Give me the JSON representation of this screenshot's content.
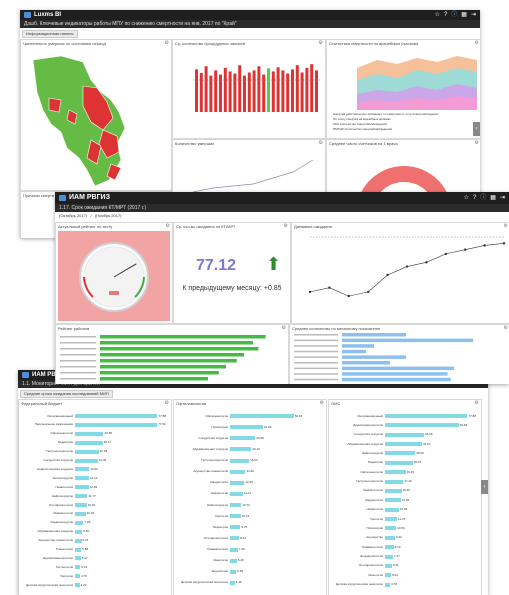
{
  "window1": {
    "app_title": "Luxms BI",
    "subtitle": "Дэшб. Ключевые индикаторы работы МПУ по снижению смертности на янв. 2017 по \"Край\"",
    "tab": "Информационная панель",
    "panels": {
      "map": "Численность умерших по состоянию период",
      "bars": "Ср. количество процедурных записей",
      "area": "Статистика смертности по врачебным участкам",
      "line": "Количество умерших",
      "donut": "Среднее число счетчиков на 1 врача",
      "bottom": "Причины смерти по участку"
    },
    "area_legend": [
      "Смертей действительно связанных со смертями от отсутствия наблюдения",
      "По числу смертей на врачебных приёмах",
      "ОКС Количество смертей/наблюдений",
      "ИМ/ОКС Количество смертей/наблюдения"
    ],
    "colors": {
      "red": "#dd3333",
      "green": "#66bb44",
      "accent_bar": "#55cc55"
    }
  },
  "window2": {
    "app_title": "ИАМ РВГИЗ",
    "subtitle": "1.17. Срок ожидания КТ/МРТ (2017 г.)",
    "breadcrumb": "(Октябрь 2017)   /   (Ноябрь 2017)",
    "panels": {
      "gauge": "Актуальный рейтинг по тесту",
      "kpi": "Ср. кол-во ожидания по КТ/МРТ",
      "trend": "Динамика ожидания",
      "bars_left": "Рейтинг районов",
      "bars_right": "Среднее количество по месячному показателю"
    },
    "kpi_value": "77.12",
    "kpi_caption": "К предыдущему месяцу: +0.85",
    "gauge_value_fraction": 0.72,
    "trend_values": [
      5,
      6,
      4,
      5,
      9,
      11,
      12,
      14,
      15,
      16,
      16.5
    ],
    "left_bars": [
      0.92,
      0.85,
      0.88,
      0.8,
      0.76,
      0.7,
      0.66,
      0.6
    ],
    "right_bars": [
      0.4,
      0.82,
      0.2,
      0.15,
      0.4,
      0.3,
      0.7,
      0.66,
      0.68
    ],
    "colors": {
      "up_arrow": "#2e8b2e",
      "kpi_text": "#7a7acc",
      "gauge_bg": "#f2a3a3"
    }
  },
  "window3": {
    "app_title": "ИАМ РВГИЗ",
    "subtitle": "1.1. Мониторинг МИП для врачей",
    "tab": "Средние сроки ожидания исследований МИП",
    "panels": {
      "p1": "Федеральный бюджет",
      "p2": "Офтальмология",
      "p3": "ОМС"
    },
    "charts": [
      {
        "labels": [
          "Интервенционный",
          "Персональное разрешение",
          "Офтальмология",
          "Педиатрия",
          "Гастроэнтерология",
          "Сосудистая хирургия",
          "Невралгическая хирургия",
          "Ангиохирургия",
          "Гематология",
          "Нейрохирургия",
          "Отоларингология",
          "Ревматология",
          "Кардиохирургия",
          "Абдоминальная хирургия",
          "Акушерство-гинекология",
          "Гинекология",
          "Дерматовенерология",
          "Гастрология",
          "Урология",
          "Детская хирургическая онкология"
        ],
        "values": [
          77.88,
          77.54,
          26.88,
          26.17,
          22.33,
          21.45,
          13.52,
          13.14,
          12.89,
          11.77,
          10.93,
          10.02,
          7.95,
          6.82,
          6.15,
          5.88,
          5.47,
          5.01,
          4.76,
          4.29
        ]
      },
      {
        "labels": [
          "Офтальмология",
          "Психиатрия",
          "Сосудистая хирургия",
          "Абдоминальная хирургия",
          "Гастроэнтерология",
          "Акушерство-гинекология",
          "Кардиология",
          "Нефрология",
          "Нейрохирургия",
          "Урология",
          "Педиатрия",
          "Отоларингология",
          "Травматология",
          "Онкология",
          "Эндоскопия",
          "Детская хирургическая онкология"
        ],
        "values": [
          60.18,
          31.06,
          23.95,
          20.12,
          18.04,
          14.62,
          13.46,
          12.11,
          10.72,
          10.14,
          9.75,
          8.61,
          7.35,
          6.48,
          5.93,
          4.46
        ]
      },
      {
        "labels": [
          "Интервенционный",
          "Дерматовенерология",
          "Сосудистая хирургия",
          "Абдоминальная хирургия",
          "Нейрохирургия",
          "Педиатрия",
          "Офтальмология",
          "Гастроэнтерология",
          "Ревматология",
          "Кардиология",
          "Неврология",
          "Урология",
          "Психиатрия",
          "Акушерство",
          "Травматология",
          "Эндокринология",
          "Отоларингология",
          "Онкология",
          "Детская хирургическая онкология"
        ],
        "values": [
          77.88,
          69.52,
          36.96,
          34.94,
          28.53,
          26.15,
          19.45,
          17.2,
          15.6,
          14.94,
          13.06,
          11.37,
          10.5,
          9.32,
          8.1,
          7.47,
          6.51,
          5.64,
          4.78
        ]
      }
    ],
    "colors": {
      "bar": "#84d9e6"
    }
  }
}
